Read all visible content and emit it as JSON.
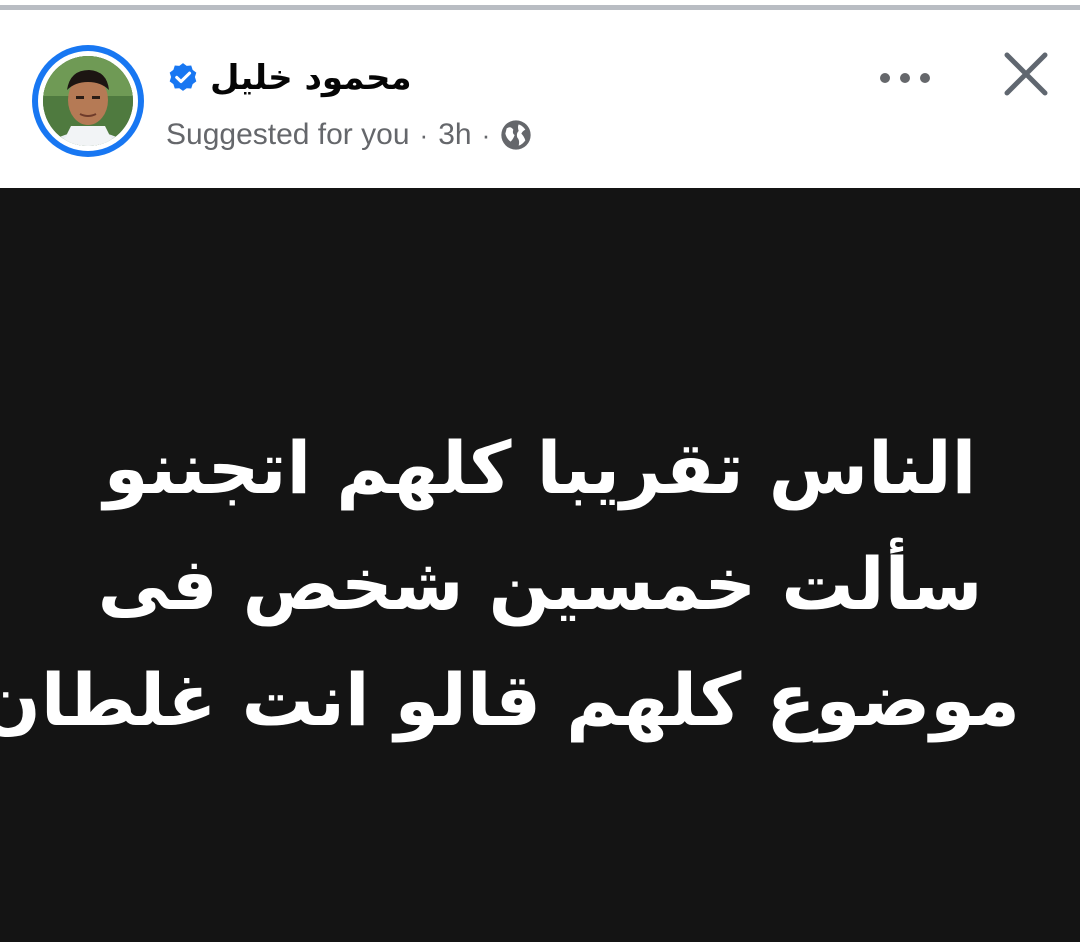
{
  "post": {
    "author_name": "محمود خليل",
    "author_verified": true,
    "meta": {
      "label": "Suggested for you",
      "separator": "·",
      "time": "3h",
      "audience_icon": "globe-icon"
    },
    "actions": {
      "more_icon": "more-horizontal-icon",
      "close_icon": "close-icon"
    },
    "body_lines": [
      "الناس تقريبا كلهم اتجننو",
      "سألت خمسين شخص فى",
      "موضوع كلهم قالو انت غلطان"
    ]
  },
  "colors": {
    "brand_blue": "#1877f2",
    "body_background": "#141414",
    "body_text": "#ffffff",
    "meta_text": "#65676b"
  }
}
